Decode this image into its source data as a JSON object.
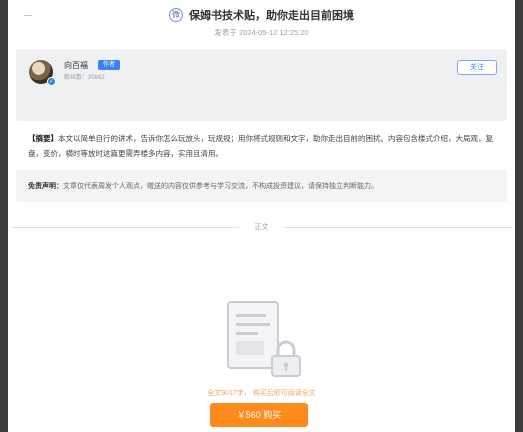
{
  "header": {
    "site_icon": "logo-icon",
    "title": "保姆书技术贴，助你走出目前困境",
    "date": "发表于 2024-05-12 12:25:20"
  },
  "author": {
    "name": "向百福",
    "badge": "作者",
    "stats": "粉丝数：20862",
    "follow_label": "关注"
  },
  "abstract": {
    "label": "【摘要】",
    "text": "本文以简单自行的讲术，告诉你怎么玩放头，玩规规；用你将式规则和文字，助你走出目前的困扰。内容包含楼式介绍，大局观，复盘，变价，横时等放时这篇更需弄楼多内容，实用且清用。"
  },
  "disclaimer": {
    "label": "免责声明：",
    "text": "文章仅代表周发个人观点，赠送的内容仅供参考与学习交流，不构成投资建议，请保持独立判断能力。"
  },
  "end_label": "正文",
  "paywall": {
    "count_text": "全文9017字， 购买后即可阅读全文",
    "buy_label": "￥560  购买"
  },
  "colors": {
    "accent": "#3b82f6",
    "buy": "#ff8a1c",
    "count_text": "#f0a46a"
  }
}
